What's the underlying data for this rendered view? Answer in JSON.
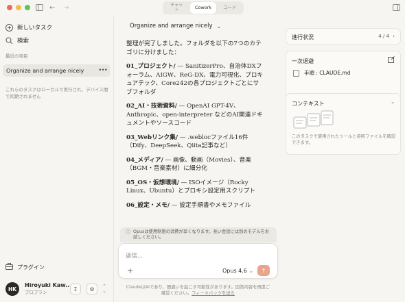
{
  "titlebar": {
    "modes": [
      {
        "label_line1": "チャッ",
        "label_line2": "ト"
      },
      {
        "label": "Cowork"
      },
      {
        "label": "コード"
      }
    ]
  },
  "sidebar": {
    "new_task": "新しいタスク",
    "search": "検索",
    "recent_header": "最近の項目",
    "task_title": "Organize and arrange nicely",
    "local_note": "これらのタスクはローカルで実行され、デバイス間で同期されません",
    "plugins": "プラグイン",
    "user_initials": "HK",
    "user_name": "Hiroyuki Kaw...",
    "user_plan": "プロプラン"
  },
  "main": {
    "chat_title": "Organize and arrange nicely",
    "intro": "整理が完了しました。フォルダを以下の7つのカテゴリに分けました：",
    "items": [
      {
        "head": "01_プロジェクト/",
        "body": " — SanitizerPro、自治体DXフォーラム、AIGW、ReG-DX、電力可視化、プロキュアテック、Core242の各プロジェクトごとにサブフォルダ"
      },
      {
        "head": "02_AI・技術資料/",
        "body": " — OpenAI GPT-4V、Anthropic、open-interpreter などのAI関連ドキュメントやソースコード"
      },
      {
        "head": "03_Webリンク集/",
        "body": " — .weblocファイル16件（Dify、DeepSeek、Qiita記事など）"
      },
      {
        "head": "04_メディア/",
        "body": " — 画像、動画（Movies）、音楽（BGM・音楽素材）に細分化"
      },
      {
        "head": "05_OS・仮想環境/",
        "body": " — ISOイメージ（Rocky Linux、Ubuntu）とプロキシ設定用スクリプト"
      },
      {
        "head": "06_設定・メモ/",
        "body": " — 設定手順書やメモファイル"
      }
    ],
    "notice": "Opusは使用制限の消費が早くなります。長い会話には別のモデルをお試しください。",
    "composer_placeholder": "返信...",
    "model": "Opus 4.6",
    "disclaimer_line1": "ClaudeはAIであり、間違いを起こす可能性があります。回答内容を再度ご",
    "disclaimer_line2": "確認ください。",
    "disclaimer_link": "フィードバックを送る"
  },
  "right": {
    "progress_label": "進行状況",
    "progress_value": "4 / 4",
    "temp_label": "一次退避",
    "temp_file": "手順 : CLAUDE.md",
    "context_label": "コンテキスト",
    "context_note": "このタスクで使用されたツールと参照ファイルを確認できます。"
  }
}
